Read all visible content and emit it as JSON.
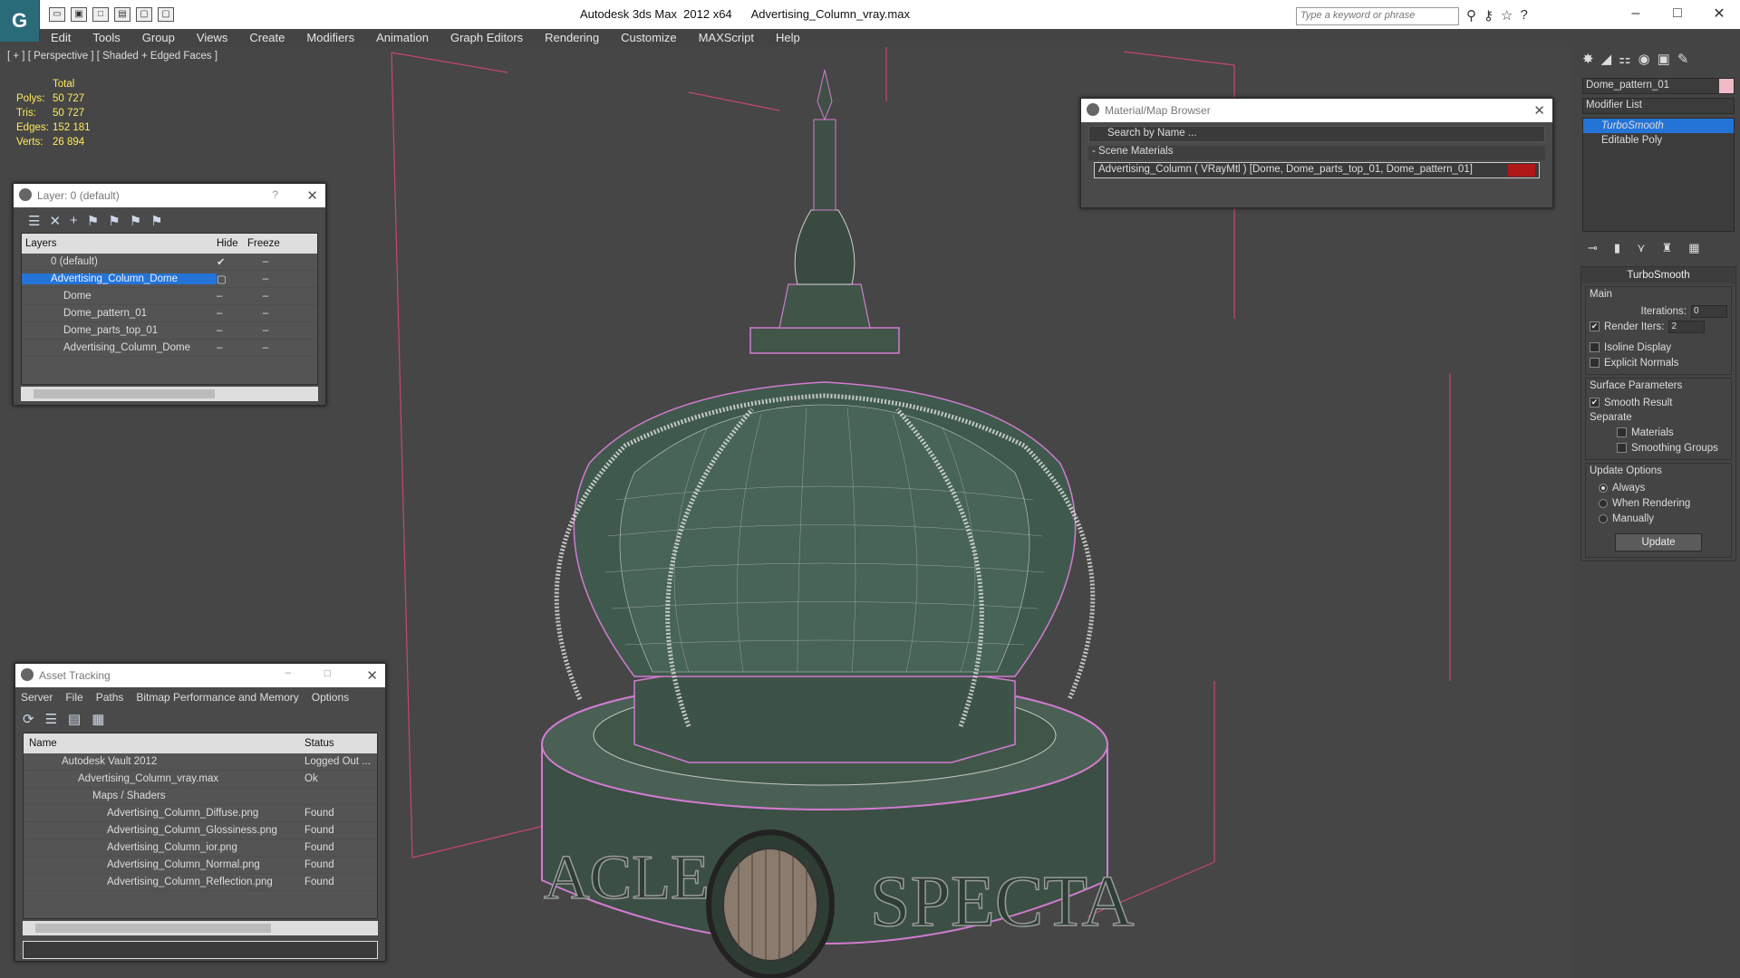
{
  "app": {
    "logo": "G",
    "title": "Autodesk 3ds Max  2012 x64      Advertising_Column_vray.max",
    "search_placeholder": "Type a keyword or phrase"
  },
  "menu": [
    "Edit",
    "Tools",
    "Group",
    "Views",
    "Create",
    "Modifiers",
    "Animation",
    "Graph Editors",
    "Rendering",
    "Customize",
    "MAXScript",
    "Help"
  ],
  "viewport": {
    "label": "[ + ] [ Perspective ] [ Shaded + Edged Faces ]",
    "stats": {
      "total": "Total",
      "polys_k": "Polys:",
      "polys": "50 727",
      "tris_k": "Tris:",
      "tris": "50 727",
      "edges_k": "Edges:",
      "edges": "152 181",
      "verts_k": "Verts:",
      "verts": "26 894"
    }
  },
  "layer": {
    "title": "Layer: 0 (default)",
    "col_layers": "Layers",
    "col_hide": "Hide",
    "col_freeze": "Freeze",
    "rows": [
      {
        "name": "0 (default)"
      },
      {
        "name": "Advertising_Column_Dome"
      },
      {
        "name": "Dome"
      },
      {
        "name": "Dome_pattern_01"
      },
      {
        "name": "Dome_parts_top_01"
      },
      {
        "name": "Advertising_Column_Dome"
      }
    ]
  },
  "asset": {
    "title": "Asset Tracking",
    "menu": [
      "Server",
      "File",
      "Paths",
      "Bitmap Performance and Memory",
      "Options"
    ],
    "col_name": "Name",
    "col_status": "Status",
    "rows": [
      {
        "name": "Autodesk Vault 2012",
        "status": "Logged Out ..."
      },
      {
        "name": "Advertising_Column_vray.max",
        "status": "Ok"
      },
      {
        "name": "Maps / Shaders",
        "status": ""
      },
      {
        "name": "Advertising_Column_Diffuse.png",
        "status": "Found"
      },
      {
        "name": "Advertising_Column_Glossiness.png",
        "status": "Found"
      },
      {
        "name": "Advertising_Column_ior.png",
        "status": "Found"
      },
      {
        "name": "Advertising_Column_Normal.png",
        "status": "Found"
      },
      {
        "name": "Advertising_Column_Reflection.png",
        "status": "Found"
      }
    ]
  },
  "material": {
    "title": "Material/Map Browser",
    "search": "Search by Name ...",
    "section": "- Scene Materials",
    "item": "Advertising_Column  ( VRayMtl ) [Dome, Dome_parts_top_01, Dome_pattern_01]"
  },
  "command": {
    "object_name": "Dome_pattern_01",
    "modifier_list": "Modifier List",
    "stack": [
      "TurboSmooth",
      "Editable Poly"
    ],
    "rollout": "TurboSmooth",
    "main": "Main",
    "iterations_label": "Iterations:",
    "iterations": "0",
    "render_iters_label": "Render Iters:",
    "render_iters": "2",
    "isoline": "Isoline Display",
    "explicit": "Explicit Normals",
    "surface": "Surface Parameters",
    "smooth": "Smooth Result",
    "separate": "Separate",
    "materials": "Materials",
    "smoothing": "Smoothing Groups",
    "update_opts": "Update Options",
    "always": "Always",
    "when_rendering": "When Rendering",
    "manually": "Manually",
    "update_btn": "Update"
  },
  "model_text": {
    "left": "ACLE",
    "right": "SPECTA"
  }
}
